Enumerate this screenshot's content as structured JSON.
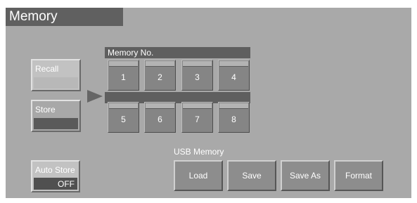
{
  "window": {
    "title": "Memory"
  },
  "recall": {
    "label": "Recall"
  },
  "store": {
    "label": "Store"
  },
  "auto_store": {
    "label": "Auto Store",
    "value": "OFF"
  },
  "memory_no": {
    "title": "Memory No.",
    "slots": [
      "1",
      "2",
      "3",
      "4",
      "5",
      "6",
      "7",
      "8"
    ]
  },
  "usb_memory": {
    "title": "USB Memory",
    "buttons": [
      "Load",
      "Save",
      "Save As",
      "Format"
    ]
  },
  "colors": {
    "panel": "#a9a9a9",
    "title_bar": "#606060",
    "text": "#ffffff"
  }
}
